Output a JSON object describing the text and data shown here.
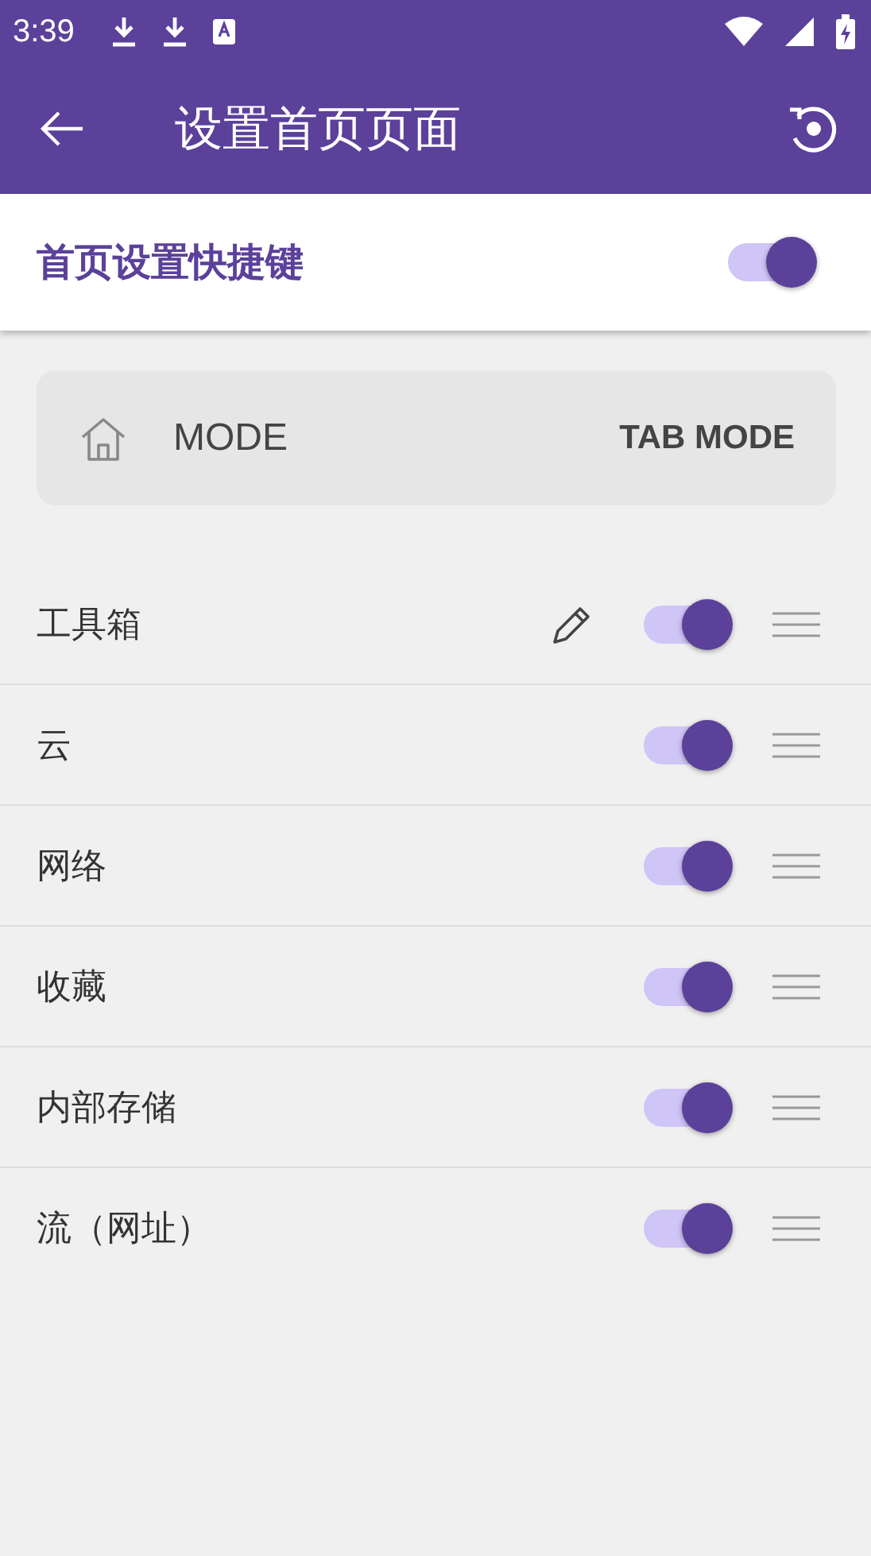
{
  "status_bar": {
    "time": "3:39"
  },
  "app_bar": {
    "title": "设置首页页面"
  },
  "shortcut": {
    "label": "首页设置快捷键",
    "on": true
  },
  "mode": {
    "label": "MODE",
    "value": "TAB MODE"
  },
  "items": [
    {
      "label": "工具箱",
      "editable": true,
      "on": true
    },
    {
      "label": "云",
      "editable": false,
      "on": true
    },
    {
      "label": "网络",
      "editable": false,
      "on": true
    },
    {
      "label": "收藏",
      "editable": false,
      "on": true
    },
    {
      "label": "内部存储",
      "editable": false,
      "on": true
    },
    {
      "label": "流（网址）",
      "editable": false,
      "on": true
    }
  ]
}
